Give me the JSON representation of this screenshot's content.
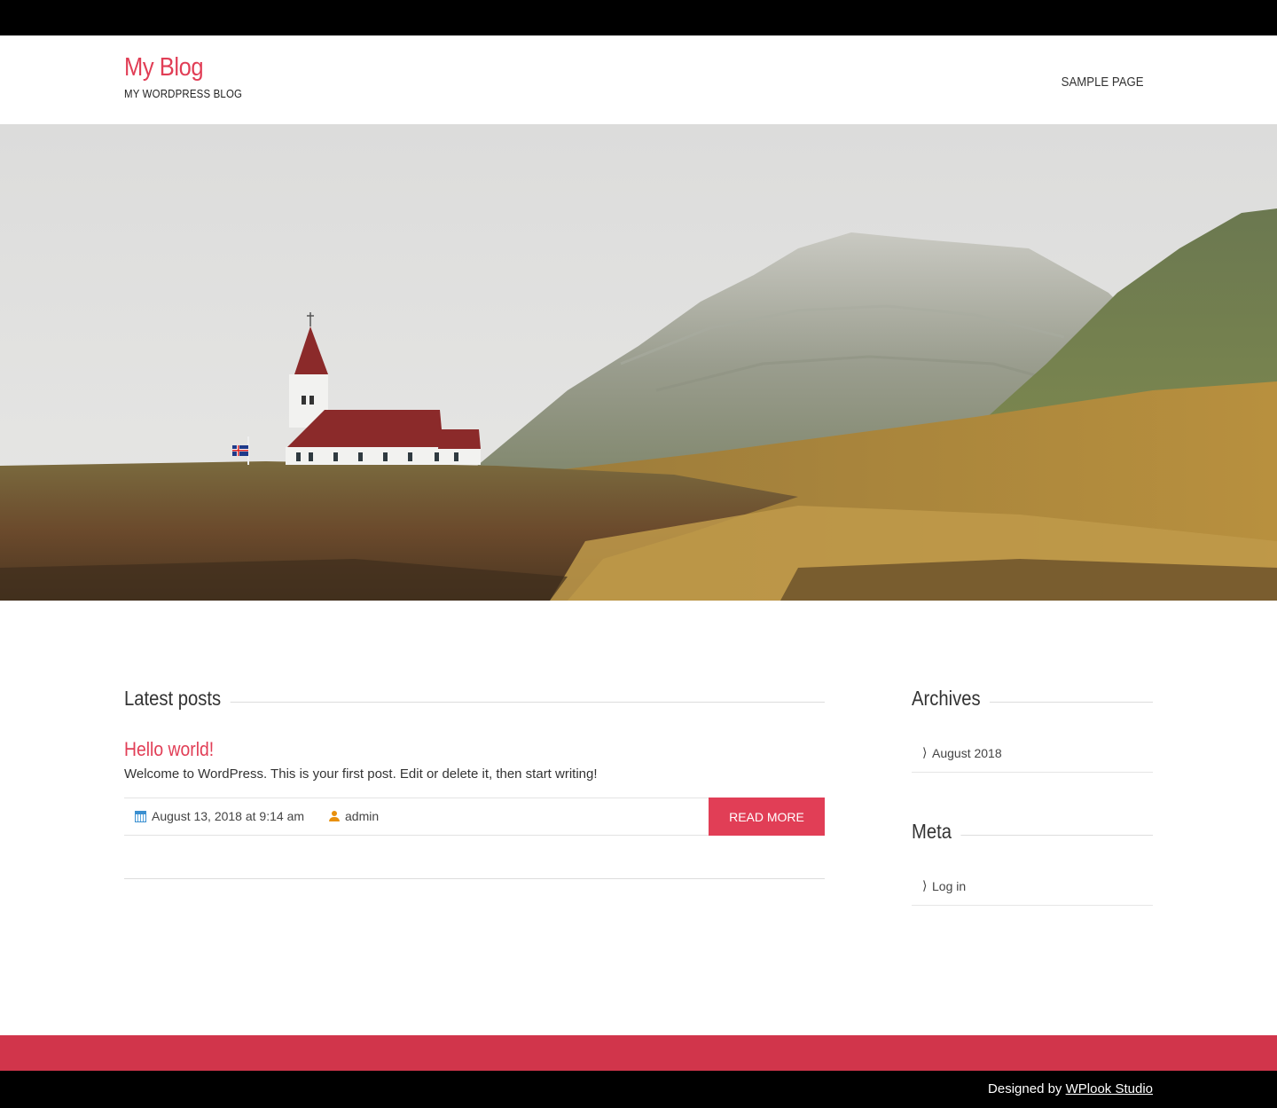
{
  "header": {
    "site_title": "My Blog",
    "site_description": "My WordPress Blog",
    "nav": [
      {
        "label": "Sample Page"
      }
    ]
  },
  "hero": {
    "image_alt": "Church on a hillside below mountains"
  },
  "main": {
    "section_title": "Latest posts",
    "posts": [
      {
        "title": "Hello world!",
        "excerpt": "Welcome to WordPress. This is your first post. Edit or delete it, then start writing!",
        "date": "August 13, 2018 at 9:14 am",
        "author": "admin",
        "read_more_label": "Read More"
      }
    ]
  },
  "sidebar": {
    "archives": {
      "title": "Archives",
      "items": [
        {
          "label": "August 2018"
        }
      ]
    },
    "meta": {
      "title": "Meta",
      "items": [
        {
          "label": "Log in"
        }
      ]
    }
  },
  "footer": {
    "credit_prefix": "Designed by",
    "credit_link": "WPlook Studio"
  },
  "colors": {
    "accent": "#e13e56",
    "footer_red": "#d1354b",
    "top_bar": "#000000"
  },
  "icons": {
    "date": "calendar-icon",
    "author": "user-icon",
    "list_bullet": "chevron-right-icon"
  }
}
